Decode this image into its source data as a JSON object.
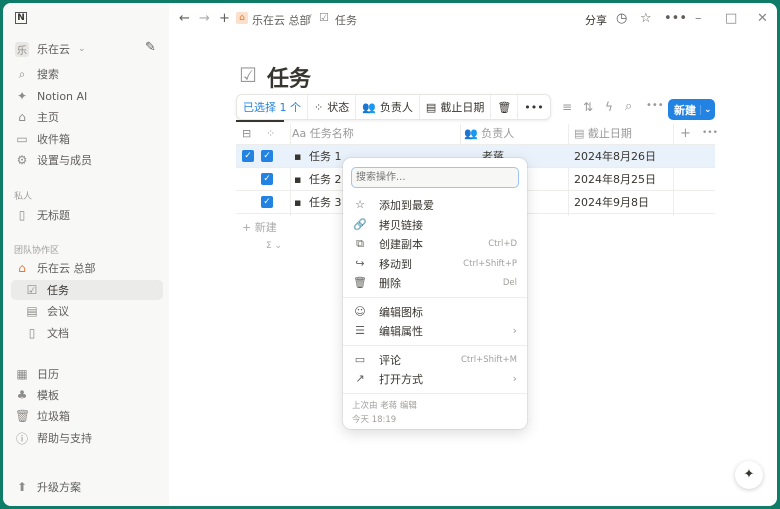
{
  "sidebar": {
    "workspace": "乐在云",
    "workspace_initial": "乐",
    "items": [
      {
        "label": "搜索",
        "icon": "search-icon"
      },
      {
        "label": "Notion AI",
        "icon": "sparkle-icon"
      },
      {
        "label": "主页",
        "icon": "home-icon"
      },
      {
        "label": "收件箱",
        "icon": "inbox-icon"
      },
      {
        "label": "设置与成员",
        "icon": "gear-icon"
      }
    ],
    "private_label": "私人",
    "private_items": [
      {
        "label": "无标题"
      }
    ],
    "team_label": "团队协作区",
    "team": "乐在云 总部",
    "team_items": [
      {
        "label": "任务"
      },
      {
        "label": "会议"
      },
      {
        "label": "文档"
      }
    ],
    "bottom_items": [
      {
        "label": "日历",
        "icon": "calendar-icon"
      },
      {
        "label": "模板",
        "icon": "shapes-icon"
      },
      {
        "label": "垃圾箱",
        "icon": "trash-icon"
      },
      {
        "label": "帮助与支持",
        "icon": "help-icon"
      }
    ],
    "upgrade": "升级方案"
  },
  "topbar": {
    "breadcrumb": [
      "乐在云 总部",
      "任务"
    ],
    "share": "分享"
  },
  "page": {
    "title": "任务"
  },
  "selection_toolbar": {
    "selected": "已选择 1 个",
    "status": "状态",
    "assignee": "负责人",
    "due": "截止日期"
  },
  "new_button": "新建",
  "table": {
    "columns": [
      "任务名称",
      "负责人",
      "截止日期"
    ],
    "rows": [
      {
        "name": "任务 1",
        "assignee": "老蒋",
        "due": "2024年8月26日",
        "selected": true
      },
      {
        "name": "任务 2",
        "assignee": "",
        "due": "2024年8月25日",
        "selected": false
      },
      {
        "name": "任务 3",
        "assignee": "",
        "due": "2024年9月8日",
        "selected": false
      }
    ],
    "new_row": "新建"
  },
  "menu": {
    "search_placeholder": "搜索操作...",
    "items": [
      {
        "label": "添加到最爱",
        "icon": "star-icon",
        "shortcut": ""
      },
      {
        "label": "拷贝链接",
        "icon": "link-icon",
        "shortcut": ""
      },
      {
        "label": "创建副本",
        "icon": "duplicate-icon",
        "shortcut": "Ctrl+D"
      },
      {
        "label": "移动到",
        "icon": "move-icon",
        "shortcut": "Ctrl+Shift+P"
      },
      {
        "label": "删除",
        "icon": "trash-icon",
        "shortcut": "Del"
      },
      {
        "label": "编辑图标",
        "icon": "smiley-icon",
        "shortcut": ""
      },
      {
        "label": "编辑属性",
        "icon": "list-icon",
        "shortcut": ""
      },
      {
        "label": "评论",
        "icon": "comment-icon",
        "shortcut": "Ctrl+Shift+M"
      },
      {
        "label": "打开方式",
        "icon": "arrow-up-right-icon",
        "shortcut": ""
      }
    ],
    "footer_edited": "上次由 老蒋 编辑",
    "footer_time": "今天 18:19"
  },
  "colors": {
    "accent": "#2383e2",
    "frame": "#0f7c68",
    "selected_row": "#e9f1fb"
  }
}
